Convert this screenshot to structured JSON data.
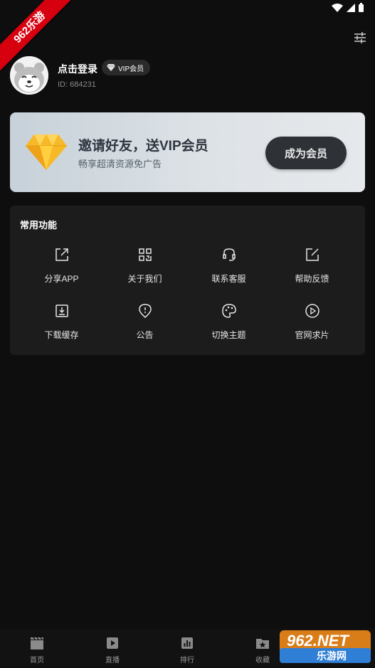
{
  "watermark_ribbon": "962乐游",
  "profile": {
    "login_label": "点击登录",
    "vip_badge": "VIP会员",
    "user_id": "ID: 684231"
  },
  "banner": {
    "title": "邀请好友，送VIP会员",
    "subtitle": "畅享超清资源免广告",
    "button": "成为会员"
  },
  "functions": {
    "title": "常用功能",
    "items": [
      {
        "label": "分享APP",
        "icon": "share-icon"
      },
      {
        "label": "关于我们",
        "icon": "qrcode-icon"
      },
      {
        "label": "联系客服",
        "icon": "headset-icon"
      },
      {
        "label": "帮助反馈",
        "icon": "edit-icon"
      },
      {
        "label": "下载缓存",
        "icon": "download-icon"
      },
      {
        "label": "公告",
        "icon": "notice-icon"
      },
      {
        "label": "切换主题",
        "icon": "palette-icon"
      },
      {
        "label": "官网求片",
        "icon": "play-circle-icon"
      }
    ]
  },
  "nav": {
    "items": [
      {
        "label": "首页",
        "icon": "clapper-icon"
      },
      {
        "label": "直播",
        "icon": "play-box-icon"
      },
      {
        "label": "排行",
        "icon": "bar-chart-icon"
      },
      {
        "label": "收藏",
        "icon": "folder-star-icon"
      }
    ]
  },
  "watermark_logo": {
    "top": "962.NET",
    "bottom": "乐游网"
  }
}
